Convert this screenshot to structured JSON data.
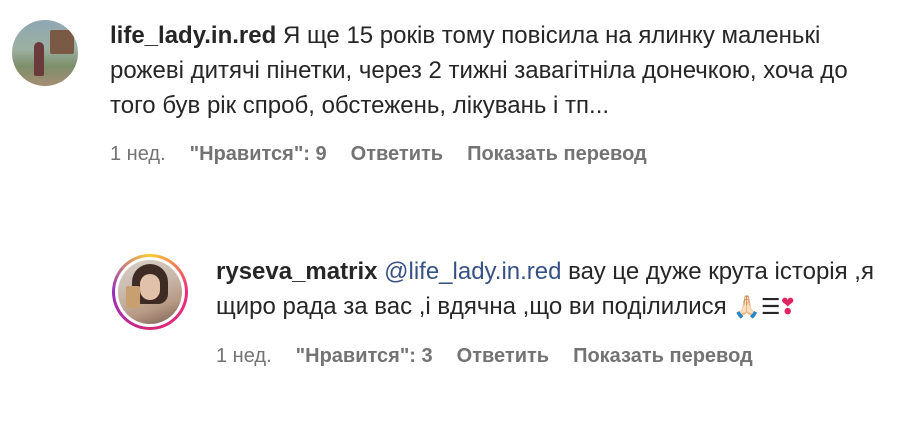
{
  "comments": [
    {
      "username": "life_lady.in.red",
      "text": "Я ще 15 років тому повісила на ялинку маленькі рожеві дитячі пінетки, через 2 тижні завагітніла донечкою, хоча до того був рік спроб, обстежень, лікувань і тп...",
      "time": "1 нед.",
      "likes_label": "\"Нравится\": 9",
      "reply_label": "Ответить",
      "translate_label": "Показать перевод"
    },
    {
      "username": "ryseva_matrix",
      "mention": "@life_lady.in.red",
      "text": "вау це дуже крута історія ,я щиро рада за вас ,і вдячна ,що ви поділилися",
      "emoji_fold": "🙏🏻",
      "emoji_bars": "☰",
      "emoji_heart": "❣",
      "time": "1 нед.",
      "likes_label": "\"Нравится\": 3",
      "reply_label": "Ответить",
      "translate_label": "Показать перевод"
    }
  ],
  "colors": {
    "text": "#262626",
    "meta": "#737373",
    "mention": "#385185",
    "story_ring": [
      "#f9ce34",
      "#ee2a7b",
      "#962fbf"
    ]
  }
}
